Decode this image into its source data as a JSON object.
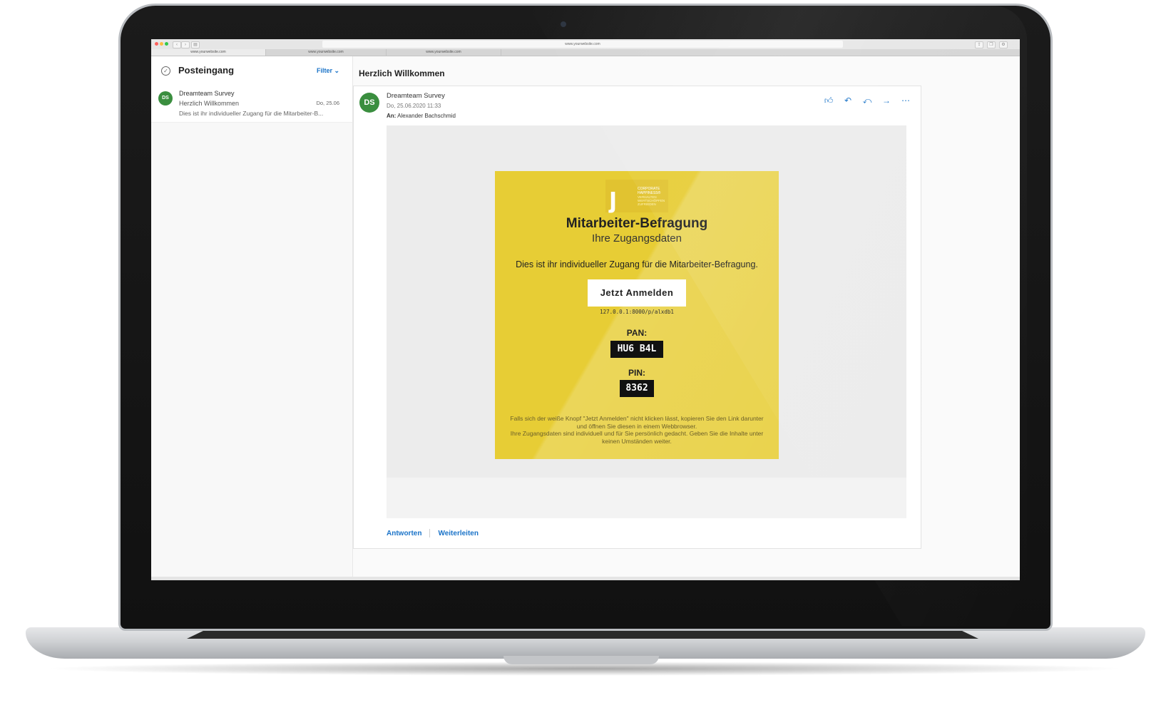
{
  "browser": {
    "url": "www.yourwebsite.com",
    "tabs": [
      "www.yourwebsite.com",
      "www.yourwebsite.com",
      "www.yourwebsite.com"
    ]
  },
  "inbox": {
    "title": "Posteingang",
    "filter_label": "Filter",
    "items": [
      {
        "avatar": "DS",
        "from": "Dreamteam Survey",
        "subject": "Herzlich Willkommen",
        "date": "Do, 25.06",
        "preview": "Dies ist ihr individueller Zugang für die Mitarbeiter-B..."
      }
    ]
  },
  "message": {
    "title": "Herzlich Willkommen",
    "avatar": "DS",
    "from": "Dreamteam Survey",
    "date": "Do, 25.06.2020 11:33",
    "to_label": "An:",
    "to": "Alexander Bachschmid",
    "actions": [
      "like-icon",
      "reply-icon",
      "reply-all-icon",
      "forward-icon",
      "more-icon"
    ],
    "reply_label": "Antworten",
    "forward_label": "Weiterleiten"
  },
  "email_body": {
    "logo_text": "CORPORATE HAPPINESS®",
    "logo_subtext": "VERHALTEN WERTSCHÖPFEN ZUFRIEDEN",
    "headline": "Mitarbeiter-Befragung",
    "subheadline": "Ihre Zugangsdaten",
    "intro": "Dies ist ihr individueller Zugang für die Mitarbeiter-Befragung.",
    "button_label": "Jetzt Anmelden",
    "link": "127.0.0.1:8000/p/alxdb1",
    "pan_label": "PAN:",
    "pan": "HU6 B4L",
    "pin_label": "PIN:",
    "pin": "8362",
    "footer_line1": "Falls sich der weiße Knopf \"Jetzt Anmelden\" nicht klicken lässt, kopieren Sie den Link darunter und öffnen Sie diesen in einem Webbrowser.",
    "footer_line2": "Ihre Zugangsdaten sind individuell und für Sie persönlich gedacht. Geben Sie die Inhalte unter keinen Umständen weiter."
  },
  "colors": {
    "accent": "#1a73c8",
    "avatar": "#3a8e3f",
    "email_yellow": "#e7cd35"
  }
}
